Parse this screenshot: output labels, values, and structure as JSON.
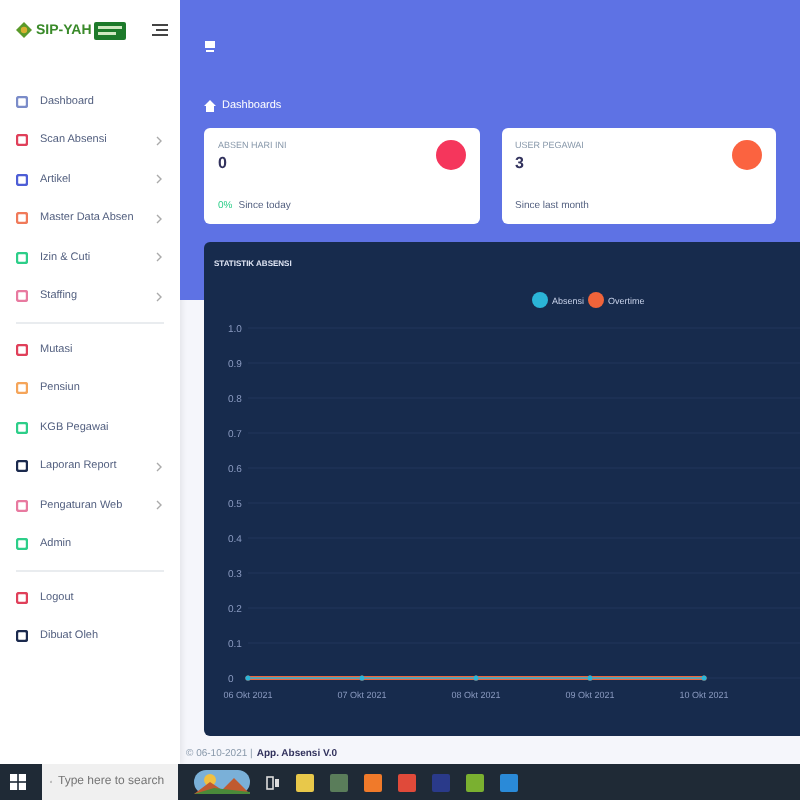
{
  "sidebar": {
    "brand": "SIP-YAH",
    "groups": [
      [
        {
          "label": "Dashboard",
          "color": "#7b8cc9",
          "has_submenu": false
        },
        {
          "label": "Scan Absensi",
          "color": "#e0405a",
          "has_submenu": true
        },
        {
          "label": "Artikel",
          "color": "#4e5ed6",
          "has_submenu": true
        },
        {
          "label": "Master Data Absen",
          "color": "#f07a5a",
          "has_submenu": true
        },
        {
          "label": "Izin & Cuti",
          "color": "#2dce89",
          "has_submenu": true
        },
        {
          "label": "Staffing",
          "color": "#e87aa0",
          "has_submenu": true
        }
      ],
      [
        {
          "label": "Mutasi",
          "color": "#e0405a",
          "has_submenu": false
        },
        {
          "label": "Pensiun",
          "color": "#f5a55a",
          "has_submenu": false
        },
        {
          "label": "KGB Pegawai",
          "color": "#2dce89",
          "has_submenu": false
        },
        {
          "label": "Laporan Report",
          "color": "#1b2a4e",
          "has_submenu": true
        },
        {
          "label": "Pengaturan Web",
          "color": "#e87aa0",
          "has_submenu": true
        },
        {
          "label": "Admin",
          "color": "#2dce89",
          "has_submenu": false
        }
      ],
      [
        {
          "label": "Logout",
          "color": "#e0405a",
          "has_submenu": false
        },
        {
          "label": "Dibuat Oleh",
          "color": "#1b2a4e",
          "has_submenu": false
        }
      ]
    ]
  },
  "breadcrumb": "Dashboards",
  "cards": [
    {
      "title": "ABSEN HARI INI",
      "value": "0",
      "change": "0%",
      "note": "Since today",
      "color": "#f5365c"
    },
    {
      "title": "USER PEGAWAI",
      "value": "3",
      "note": "Since last month",
      "color": "#fb6340"
    }
  ],
  "chart": {
    "title": "STATISTIK ABSENSI",
    "chart_data": {
      "type": "line",
      "categories": [
        "06 Okt 2021",
        "07 Okt 2021",
        "08 Okt 2021",
        "09 Okt 2021",
        "10 Okt 2021"
      ],
      "series": [
        {
          "name": "Absensi",
          "color": "#2bb5d8",
          "values": [
            0,
            0,
            0,
            0,
            0
          ]
        },
        {
          "name": "Overtime",
          "color": "#f0643a",
          "values": [
            0,
            0,
            0,
            0,
            0
          ]
        }
      ],
      "legend": true,
      "grid": true,
      "ylim": [
        0,
        1
      ],
      "yticks": [
        {
          "value": 0,
          "label": "0"
        },
        {
          "value": 0.1,
          "label": "0.1"
        },
        {
          "value": 0.2,
          "label": "0.2"
        },
        {
          "value": 0.3,
          "label": "0.3"
        },
        {
          "value": 0.4,
          "label": "0.4"
        },
        {
          "value": 0.5,
          "label": "0.5"
        },
        {
          "value": 0.6,
          "label": "0.6"
        },
        {
          "value": 0.7,
          "label": "0.7"
        },
        {
          "value": 0.8,
          "label": "0.8"
        },
        {
          "value": 0.9,
          "label": "0.9"
        },
        {
          "value": 1,
          "label": "1.0"
        }
      ]
    }
  },
  "footer": {
    "date": "© 06-10-2021 |",
    "app": "App. Absensi V.0"
  },
  "taskbar": {
    "search_placeholder": "Type here to search"
  }
}
